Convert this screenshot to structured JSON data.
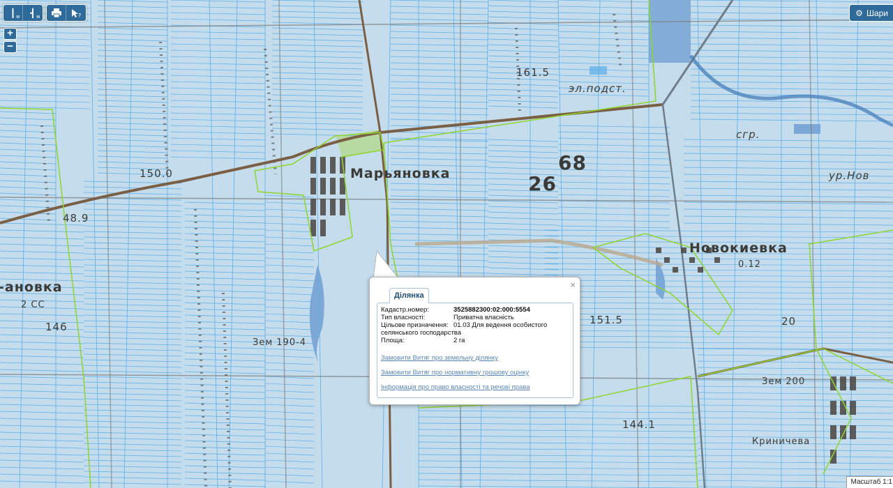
{
  "toolbar": {
    "buttons": [
      {
        "name": "ruler-length",
        "label": "м"
      },
      {
        "name": "ruler-area",
        "label": "м"
      },
      {
        "name": "print"
      },
      {
        "name": "identify"
      }
    ]
  },
  "zoom": {
    "in": "+",
    "out": "−"
  },
  "layers_button": {
    "label": "Шари"
  },
  "scale": {
    "label": "Масштаб 1:1"
  },
  "map_labels": {
    "town1": "Марьяновка",
    "town2": "Новокиевка",
    "town3": "-ановка",
    "town4": "ур.Нов",
    "num_150": "150.0",
    "num_1615": "161.5",
    "num_26": "26",
    "num_68": "68",
    "el_podst": "эл.подст.",
    "sgr": "сгр.",
    "num_1515": "151.5",
    "num_1441": "144.1",
    "num_146": "146",
    "num_489": "48.9",
    "num_20": "20",
    "num_012": "0.12",
    "zem200": "Зем 200",
    "zem190": "Зем 190-4",
    "krinich": "Криничева",
    "num_ss": "2 СС"
  },
  "popup": {
    "tab": "Ділянка",
    "close": "×",
    "fields": [
      {
        "key": "Кадастр.номер:",
        "value": "3525882300:02:000:5554"
      },
      {
        "key": "Тип власності:",
        "value": "Приватна власність"
      },
      {
        "key": "Цільове призначення:",
        "value": "01.03 Для ведення особистого"
      },
      {
        "key": "Площа:",
        "value": "2 га"
      }
    ],
    "purpose_cont": "селянського господарства",
    "links": [
      "Замовити Витяг про земельну ділянку",
      "Замовити Витяг про нормативну грошову оцінку",
      "Інформація про право власності та речові права"
    ]
  },
  "colors": {
    "parcel_fill": "#c4dcec",
    "parcel_line": "#5aaee8",
    "boundary": "#8ed62e",
    "road": "#7a5f45",
    "ui_blue": "#2f6b9a"
  }
}
